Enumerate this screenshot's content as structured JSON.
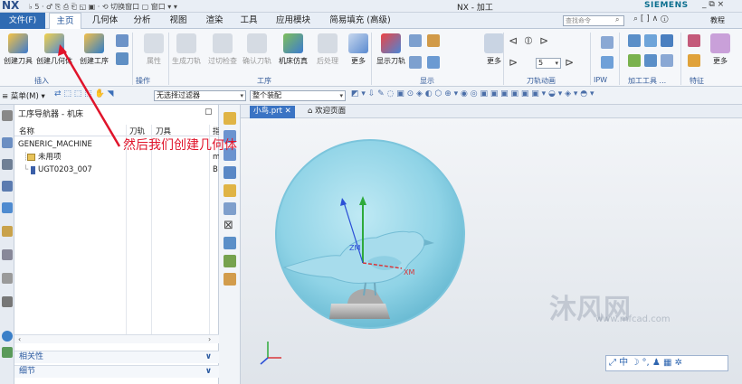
{
  "titlebar": {
    "logo": "NX",
    "quick_access": "♭ 5 · ♂ ⎘ ⎙ ⎗ ◱ ▣ · ⟲ 切换窗口 ▢ 窗口 ▾ ▾",
    "window_title": "NX - 加工",
    "brand": "SIEMENS",
    "window_controls": "_ ⧉ ×"
  },
  "menubar": {
    "file_label": "文件(F)",
    "tabs": [
      "主页",
      "几何体",
      "分析",
      "视图",
      "渲染",
      "工具",
      "应用模块",
      "简易填充 (高级)"
    ],
    "search_placeholder": "查找命令",
    "right_icons": "⌕ [ ] ∧ ⓘ",
    "help_label": "教程"
  },
  "ribbon": {
    "buttons": [
      {
        "label": "创建刀具"
      },
      {
        "label": "创建几何体"
      },
      {
        "label": "创建工序"
      },
      {
        "label": "属性"
      },
      {
        "label": "生成刀轨"
      },
      {
        "label": "过切检查"
      },
      {
        "label": "确认刀轨"
      },
      {
        "label": "机床仿真"
      },
      {
        "label": "后处理"
      },
      {
        "label": "更多"
      },
      {
        "label": "显示刀轨"
      },
      {
        "label": "更多"
      },
      {
        "label": "更多"
      },
      {
        "label": "更多"
      }
    ],
    "groups": [
      "插入",
      "操作",
      "工序",
      "显示",
      "刀轨动画",
      "IPW",
      "加工工具 ...",
      "特征"
    ],
    "speed_value": "5"
  },
  "selbar": {
    "menu_label": "菜单(M)",
    "filter_value": "无选择过滤器",
    "assembly_value": "整个装配"
  },
  "navigator": {
    "title": "工序导航器 - 机床",
    "columns": [
      "名称",
      "刀轨",
      "刀具",
      "指"
    ],
    "rows": [
      {
        "name": "GENERIC_MACHINE",
        "col4": ""
      },
      {
        "name": "未用项",
        "col4": "m"
      },
      {
        "name": "UGT0203_007",
        "col4": "B"
      }
    ],
    "panels": [
      "相关性",
      "细节"
    ]
  },
  "graphics": {
    "tabs": [
      "小鸟.prt",
      "欢迎页面"
    ],
    "annotation": "然后我们创建几何体",
    "watermark_main": "沐风网",
    "watermark_sub": "www.mfcad.com",
    "axes": {
      "zm": "ZM",
      "xm": "XM"
    },
    "view_toolbar": "⤢ 中 ☽ °, ♟ ▦ ✲"
  },
  "colors": {
    "accent": "#2f6bb3",
    "annotation": "#e0142b",
    "model": "#8fd3e6",
    "tab_active": "#3b74c4"
  }
}
